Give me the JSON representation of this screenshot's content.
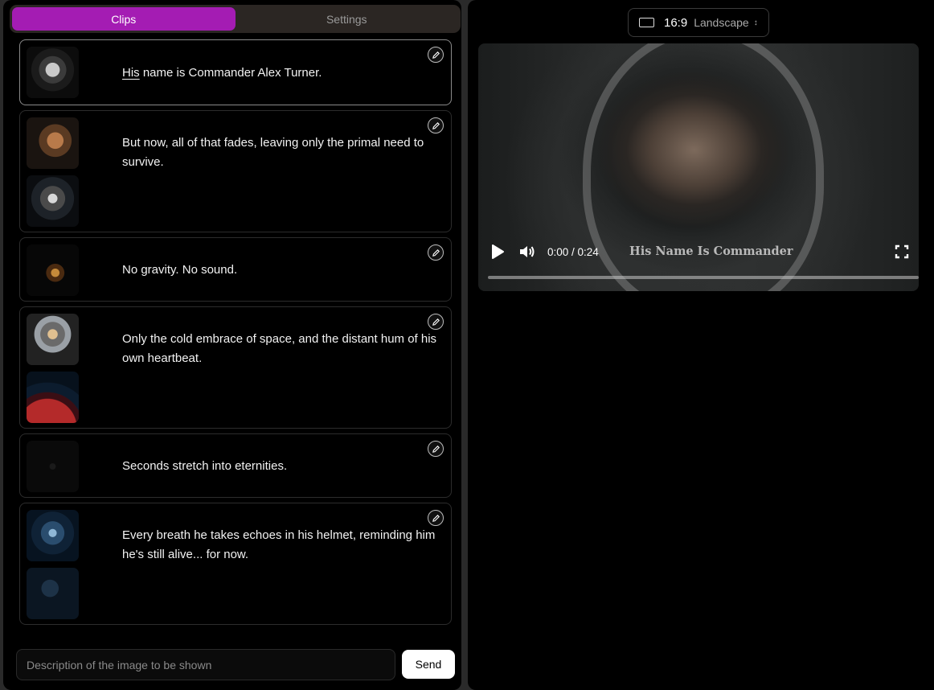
{
  "tabs": [
    {
      "label": "Clips",
      "active": true
    },
    {
      "label": "Settings",
      "active": false
    }
  ],
  "clips": [
    {
      "underlined": "His",
      "rest": " name is Commander Alex Turner.",
      "thumbs": [
        "astronaut-helmet-portrait"
      ],
      "selected": true
    },
    {
      "text": "But now, all of that fades, leaving only the primal need to survive.",
      "thumbs": [
        "man-face-space",
        "astronaut-helmet"
      ]
    },
    {
      "text": "No gravity. No sound.",
      "thumbs": [
        "floating-astronaut"
      ]
    },
    {
      "text": "Only the cold embrace of space, and the distant hum of his own heartbeat.",
      "thumbs": [
        "astronaut-closeup",
        "red-planet"
      ]
    },
    {
      "text": "Seconds stretch into eternities.",
      "thumbs": [
        "dark-space"
      ]
    },
    {
      "text": "Every breath he takes echoes in his helmet, reminding him he's still alive... for now.",
      "thumbs": [
        "blue-astronaut",
        "dark-blue-astronaut"
      ]
    }
  ],
  "input": {
    "placeholder": "Description of the image to be shown",
    "value": ""
  },
  "send_label": "Send",
  "aspect": {
    "ratio": "16:9",
    "mode": "Landscape"
  },
  "player": {
    "time": "0:00 / 0:24",
    "caption": "His Name Is Commander",
    "progress": 0
  },
  "colors": {
    "accent": "#a41cb3"
  },
  "icons": [
    "edit-icon",
    "play-icon",
    "volume-icon",
    "fullscreen-icon",
    "aspect-ratio-icon",
    "chevron-updown-icon"
  ]
}
